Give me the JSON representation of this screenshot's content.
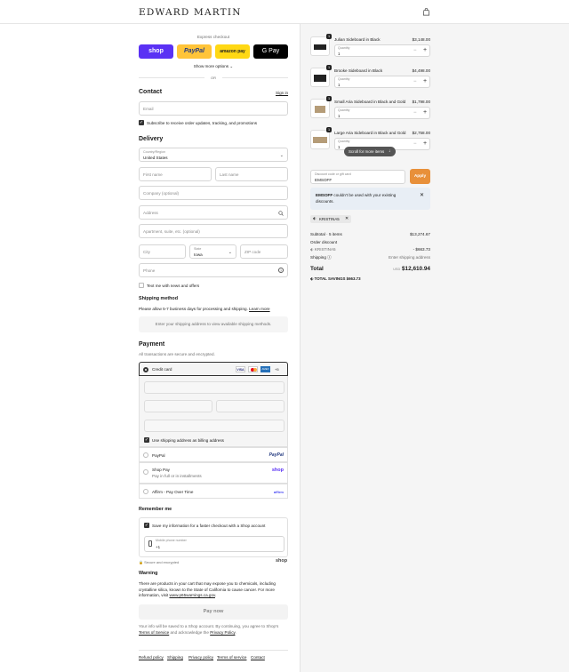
{
  "header": {
    "brand": "EDWARD MARTIN",
    "cart_icon": "bag-icon"
  },
  "express": {
    "title": "Express checkout",
    "buttons": [
      {
        "label": "shop",
        "color": "#5a31f4"
      },
      {
        "label": "PayPal",
        "color": "#ffc439"
      },
      {
        "label": "amazon pay",
        "color": "#ffd814"
      },
      {
        "label": "G Pay",
        "color": "#000000"
      }
    ],
    "show_more": "Show more options",
    "or": "OR"
  },
  "contact": {
    "title": "Contact",
    "sign_in": "Sign in",
    "email_placeholder": "Email",
    "subscribe_label": "Subscribe to receive order updates, tracking, and promotions"
  },
  "delivery": {
    "title": "Delivery",
    "country_label": "Country/Region",
    "country_value": "United States",
    "first_name": "First name",
    "last_name": "Last name",
    "company": "Company (optional)",
    "address": "Address",
    "apartment": "Apartment, suite, etc. (optional)",
    "city": "City",
    "state_label": "State",
    "state_value": "Iowa",
    "zip": "ZIP code",
    "phone": "Phone",
    "news_label": "Text me with news and offers"
  },
  "shipping": {
    "title": "Shipping method",
    "note": "Please allow 5-7 business days for processing and shipping.",
    "learn_more": "Learn more",
    "placeholder": "Enter your shipping address to view available shipping methods."
  },
  "payment": {
    "title": "Payment",
    "subtitle": "All transactions are secure and encrypted.",
    "credit_card": "Credit card",
    "card_more": "+5",
    "billing_label": "Use shipping address as billing address",
    "paypal": "PayPal",
    "shop_pay": "Shop Pay",
    "shop_pay_sub": "Pay in full or in installments",
    "affirm": "Affirm - Pay Over Time"
  },
  "remember": {
    "title": "Remember me",
    "save_label": "Save my information for a faster checkout with a Shop account",
    "mobile_label": "Mobile phone number",
    "mobile_value": "+1",
    "secure": "Secure and encrypted",
    "shop": "shop"
  },
  "warning": {
    "title": "Warning",
    "text": "There are products in your cart that may expose you to chemicals, including crystalline silica, known to the State of California to cause cancer. For more information, visit",
    "link": "www.p65warnings.ca.gov",
    "end": "."
  },
  "pay_now": "Pay now",
  "terms": {
    "text1": "Your info will be saved to a Shop account. By continuing, you agree to Shop's",
    "terms_link": "Terms of Service",
    "text2": "and acknowledge the",
    "privacy_link": "Privacy Policy",
    "end": "."
  },
  "footer": [
    "Refund policy",
    "Shipping",
    "Privacy policy",
    "Terms of service",
    "Contact"
  ],
  "cart": {
    "items": [
      {
        "name": "Julian Sideboard in Black",
        "price": "$3,148.00",
        "qty_label": "Quantity",
        "qty": "1",
        "badge": "1"
      },
      {
        "name": "Brooke Sideboard in Black",
        "price": "$4,498.00",
        "qty_label": "Quantity",
        "qty": "1",
        "badge": "1"
      },
      {
        "name": "Small Aria Sideboard in Black and Gold",
        "price": "$1,798.00",
        "qty_label": "Quantity",
        "qty": "1",
        "badge": "1"
      },
      {
        "name": "Large Aria Sideboard in Black and Gold",
        "price": "$2,758.00",
        "qty_label": "Quantity",
        "qty": "1",
        "badge": "1"
      }
    ],
    "scroll_tip": "Scroll for more items",
    "discount_label": "Discount code or gift card",
    "discount_value": "EMSOFF",
    "apply": "Apply",
    "apply_color": "#e8903a",
    "error_code": "EMSOFF",
    "error_text": "couldn't be used with your existing discounts.",
    "tag": "KRISTINA5"
  },
  "summary": {
    "subtotal_label": "Subtotal · 5 items",
    "subtotal": "$13,274.67",
    "order_discount": "Order discount",
    "discount_code": "KRISTINA5",
    "discount_value": "- $663.73",
    "shipping_label": "Shipping",
    "shipping_value": "Enter shipping address",
    "total_label": "Total",
    "currency": "USD",
    "total": "$12,610.94",
    "savings_label": "TOTAL SAVINGS",
    "savings": "$663.73"
  }
}
